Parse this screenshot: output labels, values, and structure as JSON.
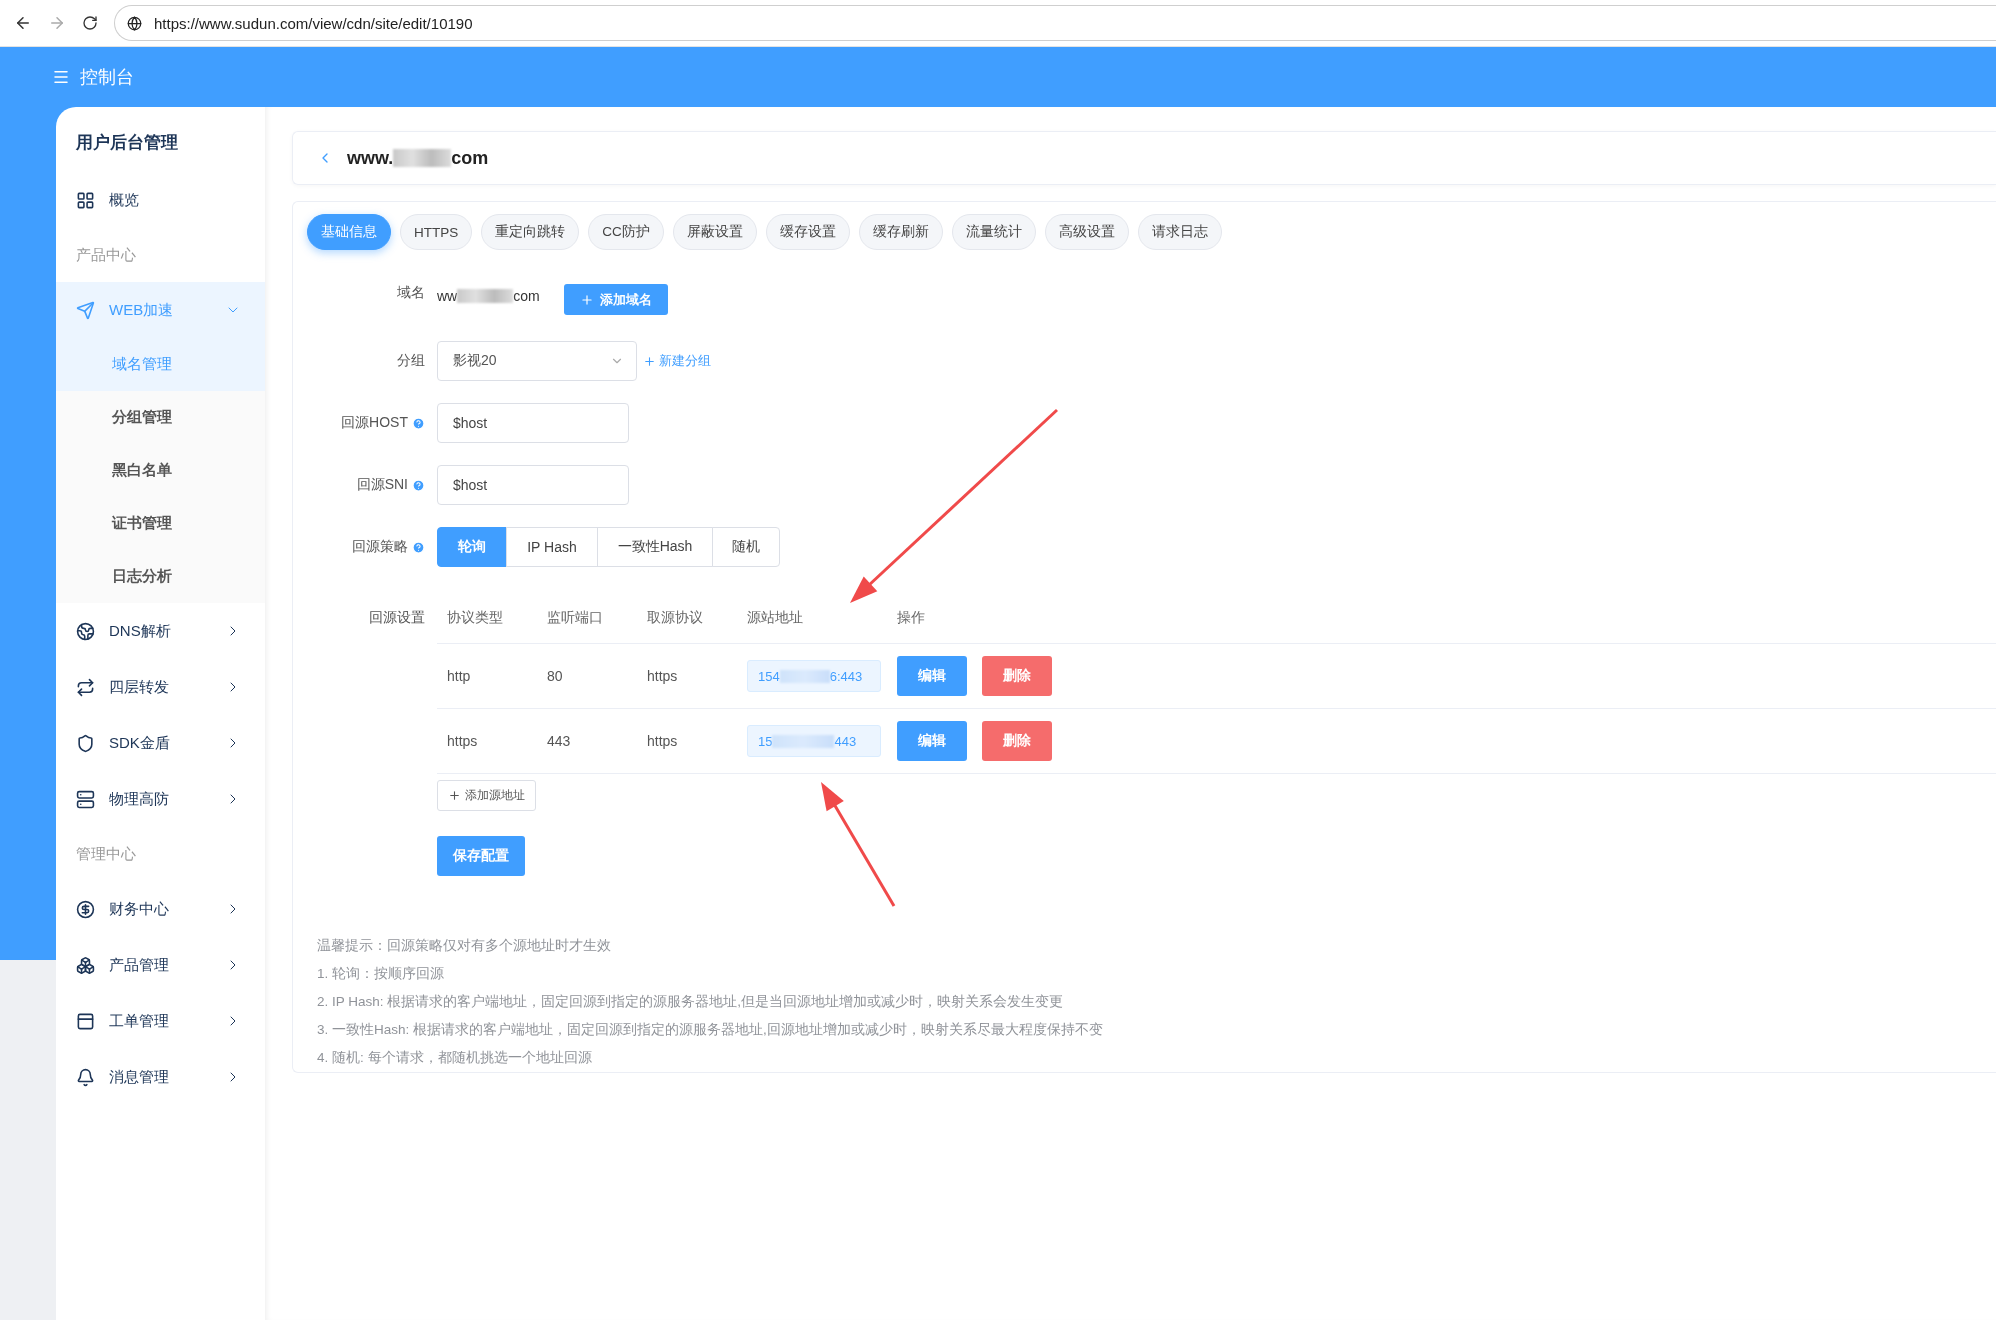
{
  "browser": {
    "url": "https://www.sudun.com/view/cdn/site/edit/10190"
  },
  "header": {
    "title": "控制台"
  },
  "sidebar": {
    "title": "用户后台管理",
    "items": [
      {
        "kind": "link",
        "label": "概览"
      },
      {
        "kind": "section",
        "label": "产品中心"
      },
      {
        "kind": "menu",
        "label": "WEB加速",
        "expanded": true,
        "children": [
          {
            "label": "域名管理",
            "selected": true
          },
          {
            "label": "分组管理",
            "selected": false
          },
          {
            "label": "黑白名单",
            "selected": false
          },
          {
            "label": "证书管理",
            "selected": false
          },
          {
            "label": "日志分析",
            "selected": false
          }
        ]
      },
      {
        "kind": "menu",
        "label": "DNS解析",
        "expanded": false
      },
      {
        "kind": "menu",
        "label": "四层转发",
        "expanded": false
      },
      {
        "kind": "menu",
        "label": "SDK金盾",
        "expanded": false
      },
      {
        "kind": "menu",
        "label": "物理高防",
        "expanded": false
      },
      {
        "kind": "section",
        "label": "管理中心"
      },
      {
        "kind": "menu",
        "label": "财务中心",
        "expanded": false
      },
      {
        "kind": "menu",
        "label": "产品管理",
        "expanded": false
      },
      {
        "kind": "menu",
        "label": "工单管理",
        "expanded": false
      },
      {
        "kind": "menu",
        "label": "消息管理",
        "expanded": false
      }
    ]
  },
  "page_header": {
    "domain_parts": [
      "www.",
      "com"
    ]
  },
  "tabs": [
    {
      "label": "基础信息",
      "selected": true
    },
    {
      "label": "HTTPS",
      "selected": false
    },
    {
      "label": "重定向跳转",
      "selected": false
    },
    {
      "label": "CC防护",
      "selected": false
    },
    {
      "label": "屏蔽设置",
      "selected": false
    },
    {
      "label": "缓存设置",
      "selected": false
    },
    {
      "label": "缓存刷新",
      "selected": false
    },
    {
      "label": "流量统计",
      "selected": false
    },
    {
      "label": "高级设置",
      "selected": false
    },
    {
      "label": "请求日志",
      "selected": false
    }
  ],
  "form": {
    "domain": {
      "label": "域名",
      "value_parts": [
        "ww",
        "com"
      ],
      "add_button": "添加域名"
    },
    "group": {
      "label": "分组",
      "value": "影视20",
      "new_link": "新建分组"
    },
    "host": {
      "label": "回源HOST",
      "value": "$host"
    },
    "sni": {
      "label": "回源SNI",
      "value": "$host"
    },
    "strategy": {
      "label": "回源策略",
      "options": [
        {
          "label": "轮询",
          "selected": true
        },
        {
          "label": "IP Hash",
          "selected": false
        },
        {
          "label": "一致性Hash",
          "selected": false
        },
        {
          "label": "随机",
          "selected": false
        }
      ]
    },
    "origins": {
      "label": "回源设置",
      "columns": [
        "协议类型",
        "监听端口",
        "取源协议",
        "源站地址",
        "操作"
      ],
      "rows": [
        {
          "protocol": "http",
          "port": "80",
          "origin_protocol": "https",
          "address_parts": [
            "154",
            "6:443"
          ],
          "edit": "编辑",
          "delete": "删除"
        },
        {
          "protocol": "https",
          "port": "443",
          "origin_protocol": "https",
          "address_parts": [
            "15",
            "443"
          ],
          "edit": "编辑",
          "delete": "删除"
        }
      ],
      "add_button": "添加源地址"
    },
    "save_button": "保存配置"
  },
  "notes": [
    "温馨提示：回源策略仅对有多个源地址时才生效",
    "1. 轮询：按顺序回源",
    "2. IP Hash: 根据请求的客户端地址，固定回源到指定的源服务器地址,但是当回源地址增加或减少时，映射关系会发生变更",
    "3. 一致性Hash: 根据请求的客户端地址，固定回源到指定的源服务器地址,回源地址增加或减少时，映射关系尽最大程度保持不变",
    "4. 随机: 每个请求，都随机挑选一个地址回源"
  ]
}
